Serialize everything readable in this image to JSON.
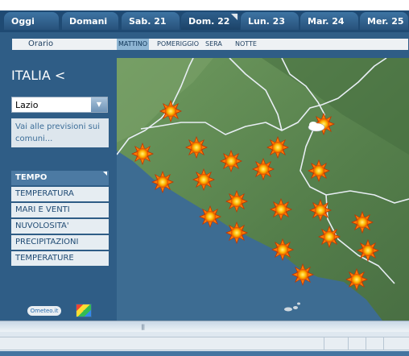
{
  "tabs": [
    {
      "label": "Oggi",
      "active": false
    },
    {
      "label": "Domani",
      "active": false
    },
    {
      "label": "Sab. 21",
      "active": false
    },
    {
      "label": "Dom. 22",
      "active": true
    },
    {
      "label": "Lun. 23",
      "active": false
    },
    {
      "label": "Mar. 24",
      "active": false
    },
    {
      "label": "Mer. 25",
      "active": false
    }
  ],
  "subnav": {
    "label": "Orario",
    "periods": [
      "MATTINO",
      "POMERIGGIO",
      "SERA",
      "NOTTE"
    ],
    "active_period": "MATTINO"
  },
  "sidebar": {
    "country": "ITALIA <",
    "region_selected": "Lazio",
    "comuni_link": "Vai alle previsioni sui comuni...",
    "menu_header": "TEMPO",
    "menu_items": [
      "TEMPERATURA",
      "MARI E VENTI",
      "NUVOLOSITA'",
      "PRECIPITAZIONI",
      "TEMPERATURE"
    ],
    "logo_text": "Ometeo.it"
  },
  "map": {
    "icons": [
      {
        "type": "sun-icon"
      },
      {
        "type": "sun-cloud-icon"
      },
      {
        "type": "sun-icon"
      },
      {
        "type": "sun-icon"
      },
      {
        "type": "sun-icon"
      },
      {
        "type": "sun-icon"
      },
      {
        "type": "sun-icon"
      },
      {
        "type": "sun-icon"
      },
      {
        "type": "sun-icon"
      },
      {
        "type": "sun-icon"
      },
      {
        "type": "sun-icon"
      },
      {
        "type": "sun-icon"
      },
      {
        "type": "sun-icon"
      },
      {
        "type": "sun-icon"
      },
      {
        "type": "sun-icon"
      },
      {
        "type": "sun-icon"
      },
      {
        "type": "sun-icon"
      },
      {
        "type": "sun-icon"
      },
      {
        "type": "sun-icon"
      },
      {
        "type": "sun-icon"
      },
      {
        "type": "sun-icon"
      }
    ]
  },
  "colors": {
    "panel": "#2f5d86",
    "sea": "#3a6a8f",
    "land": "#5c8a52",
    "sun": "#ff9a00"
  }
}
